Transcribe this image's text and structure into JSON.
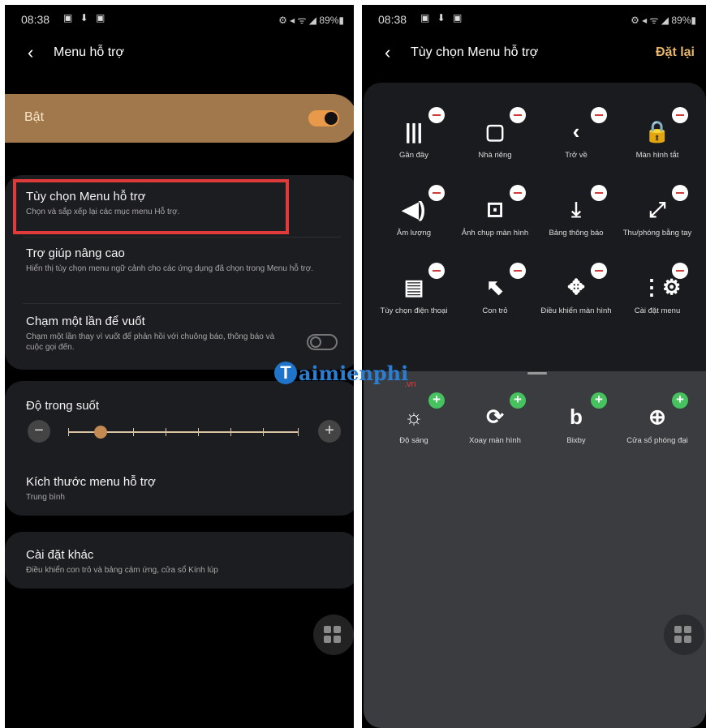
{
  "left": {
    "status": {
      "time": "08:38",
      "icons": "▣ ⬇ ▣",
      "right": "⚙ ◂ ᯤ ◢ 89%▮"
    },
    "title": "Menu hỗ trợ",
    "toggle": {
      "label": "Bật",
      "on": true
    },
    "options": [
      {
        "title": "Tùy chọn Menu hỗ trợ",
        "subtitle": "Chọn và sắp xếp lại các mục menu Hỗ trợ."
      },
      {
        "title": "Trợ giúp nâng cao",
        "subtitle": "Hiển thị tùy chọn menu ngữ cảnh cho các ứng dụng đã chọn trong Menu hỗ trợ."
      },
      {
        "title": "Chạm một lần để vuốt",
        "subtitle": "Chạm một lần thay vì vuốt để phản hồi với chuông báo, thông báo và cuộc gọi đến."
      }
    ],
    "transparency": {
      "title": "Độ trong suốt",
      "minus": "−",
      "plus": "+",
      "level": 0.14
    },
    "size": {
      "title": "Kích thước menu hỗ trợ",
      "value": "Trung bình"
    },
    "other": {
      "title": "Cài đặt khác",
      "subtitle": "Điều khiển con trỏ và bảng cảm ứng, cửa sổ Kính lúp"
    }
  },
  "right": {
    "status": {
      "time": "08:38",
      "icons": "▣ ⬇ ▣",
      "right": "⚙ ◂ ᯤ ◢ 89%▮"
    },
    "title": "Tùy chọn Menu hỗ trợ",
    "reset": "Đặt lại",
    "active_items": [
      {
        "label": "Gần đây",
        "icon": "|||"
      },
      {
        "label": "Nhà riêng",
        "icon": "▢"
      },
      {
        "label": "Trở về",
        "icon": "‹"
      },
      {
        "label": "Màn hình tắt",
        "icon": "🔒"
      },
      {
        "label": "Âm lượng",
        "icon": "◀)"
      },
      {
        "label": "Ảnh chụp màn hình",
        "icon": "⊡"
      },
      {
        "label": "Bảng thông báo",
        "icon": "⤓"
      },
      {
        "label": "Thu/phóng bằng tay",
        "icon": "⤢"
      },
      {
        "label": "Tùy chọn điện thoại",
        "icon": "▤"
      },
      {
        "label": "Con trỏ",
        "icon": "⬉"
      },
      {
        "label": "Điều khiển màn hình",
        "icon": "✥"
      },
      {
        "label": "Cài đặt menu",
        "icon": "⋮⚙"
      }
    ],
    "available_items": [
      {
        "label": "Độ sáng",
        "icon": "☼"
      },
      {
        "label": "Xoay màn hình",
        "icon": "⟳"
      },
      {
        "label": "Bixby",
        "icon": "b"
      },
      {
        "label": "Cửa sổ phóng đại",
        "icon": "⊕"
      }
    ]
  },
  "watermark": {
    "main": "aimienphi",
    "letter": "T",
    "suffix": ".vn"
  }
}
